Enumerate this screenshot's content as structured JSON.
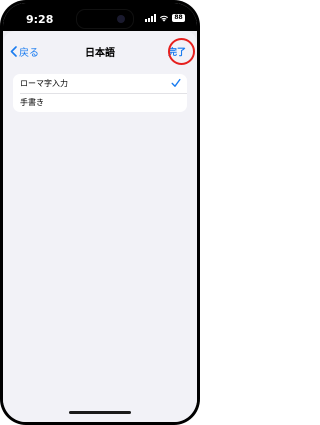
{
  "status_bar": {
    "time": "9:28",
    "battery": "88"
  },
  "nav": {
    "back_label": "戻る",
    "title": "日本語",
    "done_label": "完了"
  },
  "keyboards": [
    {
      "label": "ローマ字入力",
      "checked": true
    },
    {
      "label": "手書き",
      "checked": false
    }
  ],
  "colors": {
    "accent": "#1a7cf0",
    "highlight": "#e6201e",
    "background": "#f2f2f7"
  }
}
